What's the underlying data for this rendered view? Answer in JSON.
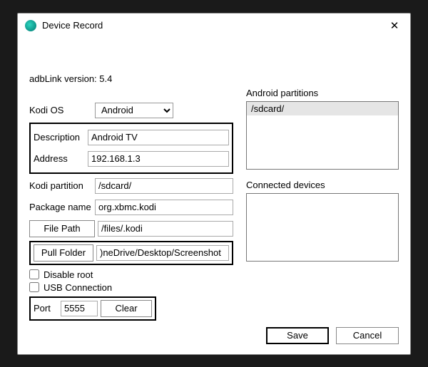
{
  "window": {
    "title": "Device Record",
    "close_glyph": "✕"
  },
  "version_line": "adbLink version: 5.4",
  "labels": {
    "kodi_os": "Kodi OS",
    "description": "Description",
    "address": "Address",
    "kodi_partition": "Kodi partition",
    "package_name": "Package name",
    "file_path": "File Path",
    "pull_folder": "Pull Folder",
    "disable_root": "Disable root",
    "usb_connection": "USB Connection",
    "port": "Port",
    "clear": "Clear",
    "android_partitions": "Android partitions",
    "connected_devices": "Connected devices",
    "save": "Save",
    "cancel": "Cancel"
  },
  "fields": {
    "kodi_os": "Android",
    "description": "Android TV",
    "address": "192.168.1.3",
    "kodi_partition": "/sdcard/",
    "package_name": "org.xbmc.kodi",
    "file_path": "/files/.kodi",
    "pull_folder": ")neDrive/Desktop/Screenshot",
    "disable_root": false,
    "usb_connection": false,
    "port": "5555"
  },
  "partitions": [
    "/sdcard/"
  ],
  "connected_devices": []
}
